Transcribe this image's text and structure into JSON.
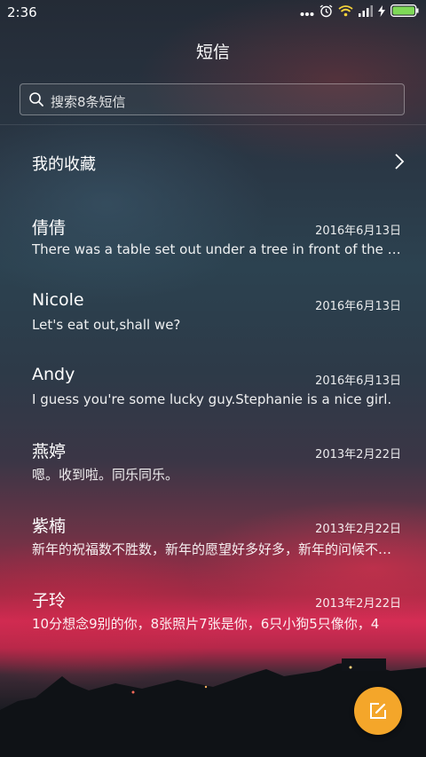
{
  "status_bar": {
    "time": "2:36",
    "icons": [
      "more-dots-icon",
      "alarm-clock-icon",
      "wifi-icon",
      "signal-icon",
      "charging-icon",
      "battery-icon"
    ]
  },
  "header": {
    "title": "短信"
  },
  "search": {
    "placeholder": "搜索8条短信"
  },
  "favorites": {
    "label": "我的收藏"
  },
  "messages": [
    {
      "name": "倩倩",
      "date": "2016年6月13日",
      "preview": "There was a table set out under a tree in front of the house"
    },
    {
      "name": "Nicole",
      "date": "2016年6月13日",
      "preview": "Let's eat out,shall we?"
    },
    {
      "name": "Andy",
      "date": "2016年6月13日",
      "preview": "I guess you're some lucky guy.Stephanie is a nice girl."
    },
    {
      "name": "燕婷",
      "date": "2013年2月22日",
      "preview": "嗯。收到啦。同乐同乐。"
    },
    {
      "name": "紫楠",
      "date": "2013年2月22日",
      "preview": "新年的祝福数不胜数，新年的愿望好多好多，新年的问候不能少"
    },
    {
      "name": "子玲",
      "date": "2013年2月22日",
      "preview": "10分想念9别的你，8张照片7张是你，6只小狗5只像你，4"
    }
  ],
  "fab": {
    "icon": "compose-icon",
    "color": "#f4a62a"
  }
}
